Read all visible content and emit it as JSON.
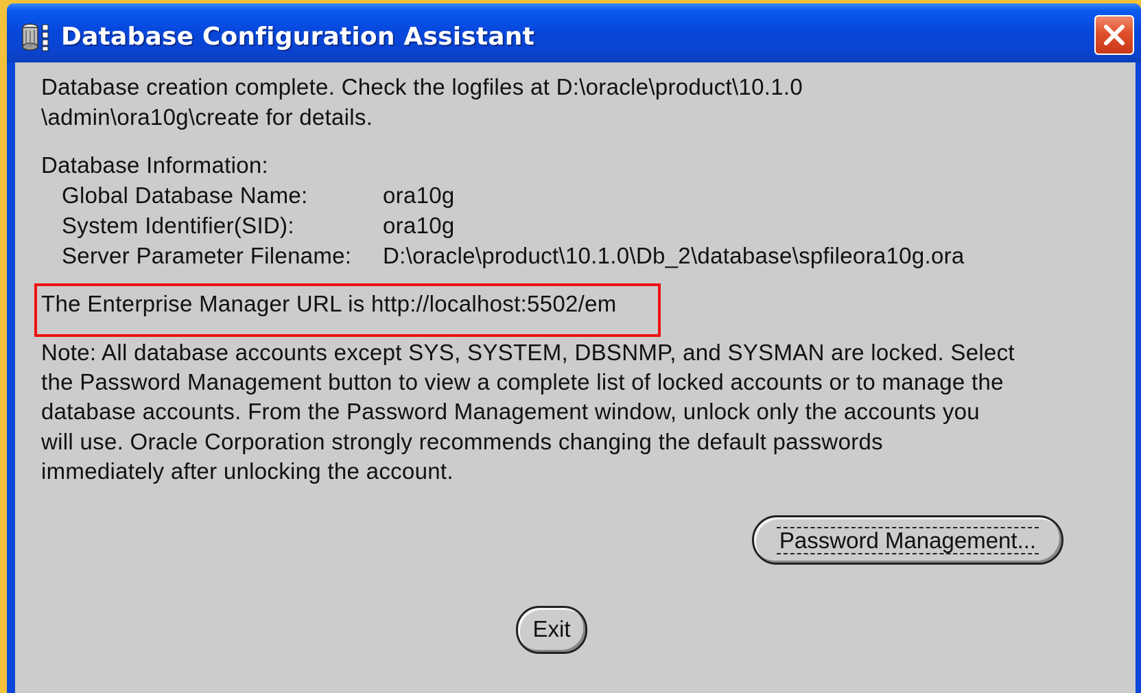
{
  "window": {
    "title": "Database Configuration Assistant",
    "icon": "database-icon",
    "close_icon": "close-icon",
    "accent_color": "#0b47d8",
    "close_color": "#e0502a"
  },
  "message": {
    "line1": "Database creation complete. Check the logfiles at D:\\oracle\\product\\10.1.0",
    "line2": "\\admin\\ora10g\\create for details."
  },
  "db_info": {
    "heading": "Database Information:",
    "rows": [
      {
        "label": "Global Database Name:",
        "value": "ora10g"
      },
      {
        "label": "System Identifier(SID):",
        "value": "ora10g"
      },
      {
        "label": "Server Parameter Filename:",
        "value": "D:\\oracle\\product\\10.1.0\\Db_2\\database\\spfileora10g.ora"
      }
    ]
  },
  "em_url_text": "The Enterprise Manager URL is http://localhost:5502/em",
  "highlight_color": "#ee1111",
  "note": {
    "lines": [
      "Note: All database accounts except SYS, SYSTEM, DBSNMP, and SYSMAN are locked. Select",
      "the Password Management button to view a complete list of locked accounts or to manage the",
      "database accounts. From the Password Management window, unlock only the accounts you",
      "will use. Oracle Corporation strongly recommends changing the default passwords",
      "immediately after unlocking the account."
    ]
  },
  "buttons": {
    "password_management": "Password Management...",
    "exit": "Exit"
  }
}
